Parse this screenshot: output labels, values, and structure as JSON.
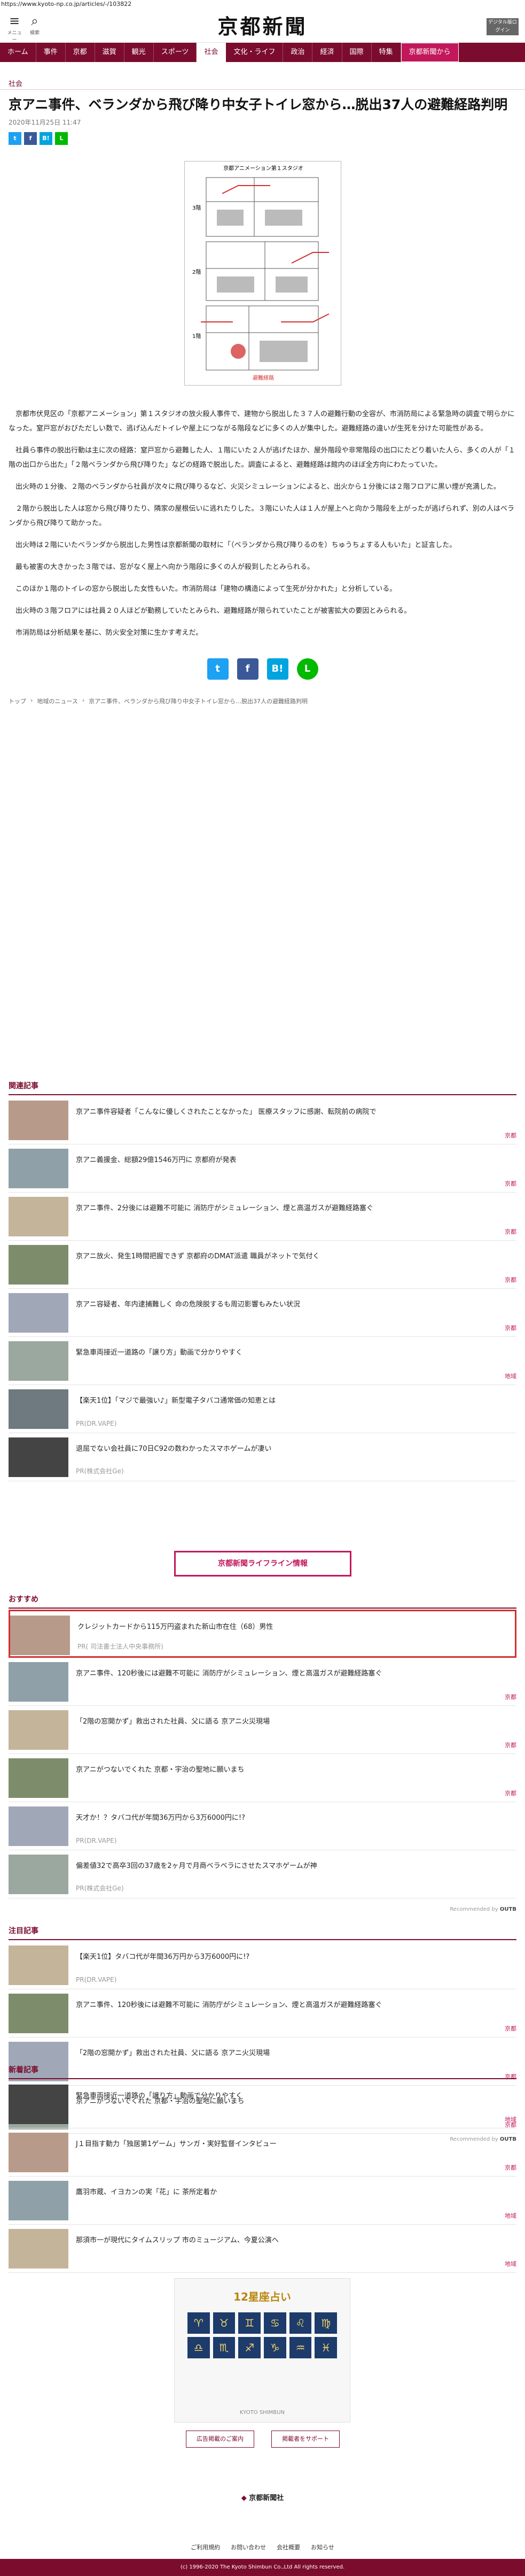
{
  "url": "https://www.kyoto-np.co.jp/articles/-/103822",
  "header": {
    "menu_label": "メニュー",
    "search_label": "検索",
    "logo": "京都新聞",
    "logo_small": "デジタル版ログイン"
  },
  "nav": [
    "ホーム",
    "事件",
    "京都",
    "滋賀",
    "観光",
    "スポーツ",
    "社会",
    "文化・ライフ",
    "政治",
    "経済",
    "国際",
    "特集",
    "京都新聞から"
  ],
  "category": "社会",
  "title": "京アニ事件、ベランダから飛び降り中女子トイレ窓から…脱出37人の避難経路判明",
  "date": "2020年11月25日 11:47",
  "share": [
    "t",
    "f",
    "B!",
    "L"
  ],
  "map": {
    "title": "京都アニメーション第１スタジオ",
    "f3": "3階",
    "f2": "2階",
    "f1": "1階",
    "legend": "避難経路"
  },
  "body": [
    "京都市伏見区の「京都アニメーション」第１スタジオの放火殺人事件で、建物から脱出した３７人の避難行動の全容が、市消防局による緊急時の調査で明らかになった。窒戸窓がおびただしい数で、逃げ込んだトイレや屋上につながる階段などに多くの人が集中した。避難経路の違いが生死を分けた可能性がある。",
    "社員ら事件の脱出行動は主に次の経路：窒戸窓から避難した人、１階にいた２人が逃げたほか、屋外階段や非常階段の出口にたどり着いた人ら、多くの人が「１階の出口から出た」「２階ベランダから飛び降りた」などの経路で脱出した。調査によると、避難経路は館内のほぼ全方向にわたっていた。",
    "出火時の１分後、２階のベランダから社員が次々に飛び降りるなど、火災シミュレーションによると、出火から１分後には２階フロアに黒い煙が充満した。",
    "２階から脱出した人は窓から飛び降りたり、隣家の屋根伝いに逃れたりした。３階にいた人は１人が屋上へと向かう階段を上がったが逃げられず、別の人はベランダから飛び降りて助かった。",
    "出火時は２階にいたベランダから脱出した男性は京都新聞の取材に「（ベランダから飛び降りるのを）ちゅうちょする人もいた」と証言した。",
    "最も被害の大きかった３階では、窓がなく屋上へ向かう階段に多くの人が殺到したとみられる。",
    "このほか１階のトイレの窓から脱出した女性もいた。市消防局は「建物の構造によって生死が分かれた」と分析している。",
    "出火時の３階フロアには社員２０人ほどが勤務していたとみられ、避難経路が限られていたことが被害拡大の要因とみられる。",
    "市消防局は分析結果を基に、防火安全対策に生かす考えだ。"
  ],
  "share_big": [
    "t",
    "f",
    "B!",
    "L"
  ],
  "breadcrumb": [
    "トップ",
    "地域のニュース",
    "京アニ事件、ベランダから飛び降り中女子トイレ窓から…脱出37人の避難経路判明"
  ],
  "related": {
    "title": "関連記事",
    "items": [
      {
        "text": "京アニ事件容疑者「こんなに優しくされたことなかった」 医療スタッフに感謝、転院前の病院で",
        "cat": "京都"
      },
      {
        "text": "京アニ義援金、総額29億1546万円に 京都府が発表",
        "cat": "京都"
      },
      {
        "text": "京アニ事件、2分後には避難不可能に 消防庁がシミュレーション、煙と高温ガスが避難経路塞ぐ",
        "cat": "京都"
      },
      {
        "text": "京アニ放火、発生1時間把握できず 京都府のDMAT派遣 職員がネットで気付く",
        "cat": "京都"
      },
      {
        "text": "京アニ容疑者、年内逮捕難しく 命の危険脱するも周辺影響もみたい状況",
        "cat": "京都"
      },
      {
        "text": "緊急車両接近一道路の「譲り方」動画で分かりやすく",
        "cat": "地域"
      },
      {
        "text": "【楽天1位】「マジで最強い♪」新型電子タバコ通常価の知恵とは",
        "cat": "",
        "pr": "PR(DR.VAPE)"
      },
      {
        "text": "退屈でない会社員に70日C92の数わかったスマホゲームが凄い",
        "cat": "",
        "pr": "PR(株式会社Ge)"
      }
    ]
  },
  "lifeline": "京都新聞ライフライン情報",
  "osusume": {
    "title": "おすすめ",
    "items": [
      {
        "text": "クレジットカードから115万円盗まれた新山市在住（68）男性",
        "pr": "PR( 司法書士法人中央事務所)"
      },
      {
        "text": "京アニ事件、120秒後には避難不可能に 消防庁がシミュレーション、煙と高温ガスが避難経路塞ぐ",
        "cat": "京都"
      },
      {
        "text": "「2階の窓開かず」救出された社員、父に語る 京アニ火災現場",
        "cat": "京都"
      },
      {
        "text": "京アニがつないでくれた 京都・宇治の聖地に願いまち",
        "cat": "京都"
      },
      {
        "text": "天才か！？タバコ代が年間36万円から3万6000円に!?",
        "pr": "PR(DR.VAPE)"
      },
      {
        "text": "偏差値32で高卒3回の37歳を2ヶ月で月商ベラベラにさせたスマホゲームが神",
        "pr": "PR(株式会社Ge)"
      }
    ]
  },
  "powered": "Recommended by",
  "powered_brand": "OUTB",
  "attention": {
    "title": "注目記事",
    "items": [
      {
        "text": "【楽天1位】タバコ代が年間36万円から3万6000円に!?",
        "pr": "PR(DR.VAPE)"
      },
      {
        "text": "京アニ事件、120秒後には避難不可能に 消防庁がシミュレーション、煙と高温ガスが避難経路塞ぐ",
        "cat": "京都"
      },
      {
        "text": "「2階の窓開かず」救出された社員、父に語る 京アニ火災現場",
        "cat": "京都"
      },
      {
        "text": "京アニがつないでくれた 京都・宇治の聖地に願いまち",
        "cat": "京都"
      }
    ]
  },
  "newest": {
    "title": "新着記事",
    "items": [
      {
        "text": "緊急車両接近一道路の「譲り方」動画で分かりやすく",
        "cat": "地域"
      },
      {
        "text": "J１目指す動力「独居第1ゲーム」サンガ・実好監督インタビュー",
        "cat": "京都"
      },
      {
        "text": "鷹羽市蔵、イヨカンの実「花」に 茶所定着か",
        "cat": "地域"
      },
      {
        "text": "那須市一が現代にタイムスリップ 市のミュージアム、今夏公演へ",
        "cat": "地域"
      }
    ]
  },
  "ad": {
    "title": "12星座占い",
    "sub": "KYOTO SHIMBUN"
  },
  "ad_buttons": [
    "広告掲載のご案内",
    "掲載者をサポート"
  ],
  "footer": {
    "logo": "京都新聞社",
    "links": [
      "ご利用規約",
      "お問い合わせ",
      "会社概要",
      "お知らせ"
    ],
    "copyright": "(c) 1996-2020 The Kyoto Shimbun Co.,Ltd All rights reserved."
  },
  "colors": {
    "brand": "#7b0c2d",
    "accent": "#c2185b",
    "twitter": "#1da1f2",
    "facebook": "#3b5998",
    "hatena": "#00a4de",
    "line": "#00b900"
  }
}
